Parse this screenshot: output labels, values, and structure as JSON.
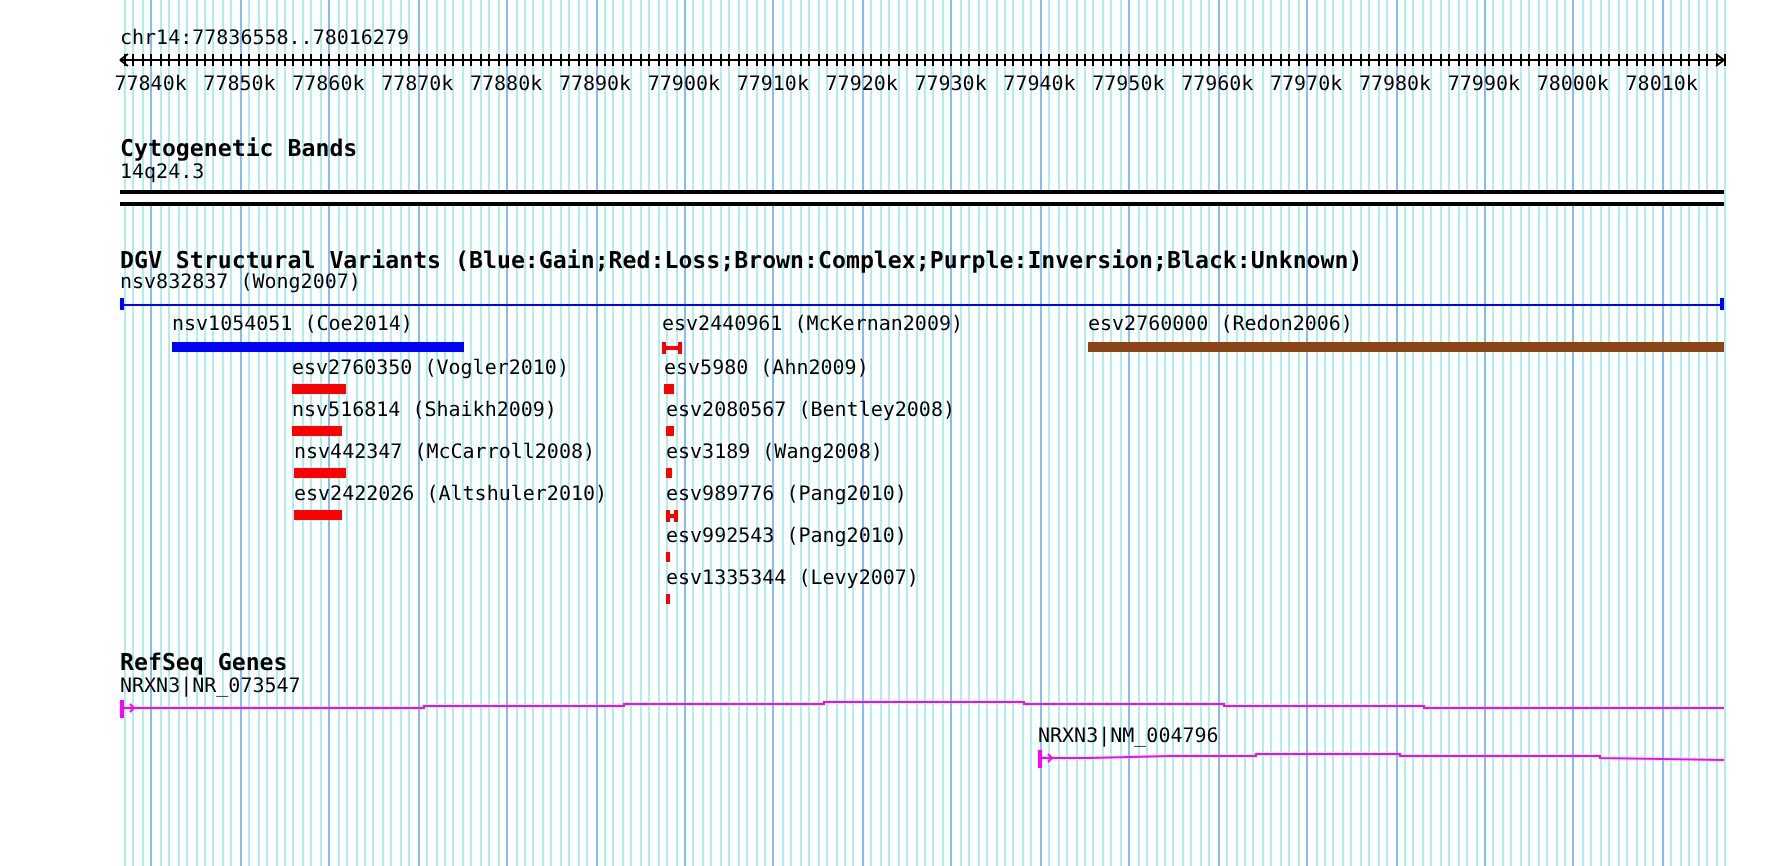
{
  "location": "chr14:77836558..78016279",
  "ruler": {
    "ticks": [
      "77840k",
      "77850k",
      "77860k",
      "77870k",
      "77880k",
      "77890k",
      "77900k",
      "77910k",
      "77920k",
      "77930k",
      "77940k",
      "77950k",
      "77960k",
      "77970k",
      "77980k",
      "77990k",
      "78000k",
      "78010k"
    ]
  },
  "tracks": [
    {
      "kind": "cytoband",
      "title": "Cytogenetic Bands",
      "features": [
        {
          "label": "14q24.3"
        }
      ]
    },
    {
      "kind": "variants",
      "title": "DGV Structural Variants (Blue:Gain;Red:Loss;Brown:Complex;Purple:Inversion;Black:Unknown)",
      "features": [
        {
          "label": "nsv832837 (Wong2007)",
          "kind": "span",
          "color": "#0000ff"
        },
        {
          "label": "nsv1054051 (Coe2014)",
          "kind": "bar",
          "color": "#0000ff"
        },
        {
          "label": "esv2760350 (Vogler2010)",
          "kind": "bar",
          "color": "#ff0000"
        },
        {
          "label": "nsv516814 (Shaikh2009)",
          "kind": "bar",
          "color": "#ff0000"
        },
        {
          "label": "nsv442347 (McCarroll2008)",
          "kind": "bar",
          "color": "#ff0000"
        },
        {
          "label": "esv2422026 (Altshuler2010)",
          "kind": "bar",
          "color": "#ff0000"
        },
        {
          "label": "esv2440961 (McKernan2009)",
          "kind": "interval",
          "color": "#ff0000"
        },
        {
          "label": "esv5980 (Ahn2009)",
          "kind": "bar",
          "color": "#ff0000"
        },
        {
          "label": "esv2080567 (Bentley2008)",
          "kind": "bar",
          "color": "#ff0000"
        },
        {
          "label": "esv3189 (Wang2008)",
          "kind": "bar",
          "color": "#ff0000"
        },
        {
          "label": "esv989776 (Pang2010)",
          "kind": "interval",
          "color": "#ff0000"
        },
        {
          "label": "esv992543 (Pang2010)",
          "kind": "bar",
          "color": "#ff0000"
        },
        {
          "label": "esv1335344 (Levy2007)",
          "kind": "bar",
          "color": "#ff0000"
        },
        {
          "label": "esv2760000 (Redon2006)",
          "kind": "bar",
          "color": "#8b4513"
        }
      ]
    },
    {
      "kind": "genes",
      "title": "RefSeq Genes",
      "features": [
        {
          "label": "NRXN3|NR_073547"
        },
        {
          "label": "NRXN3|NM_004796"
        }
      ]
    }
  ]
}
